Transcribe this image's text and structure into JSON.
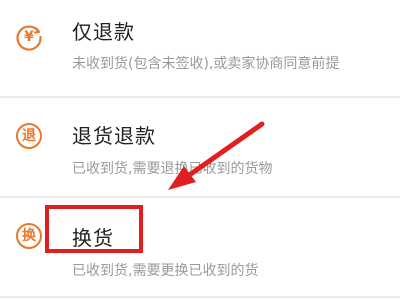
{
  "options": [
    {
      "icon": "yen-return-icon",
      "icon_char": "¥",
      "title": "仅退款",
      "desc": "未收到货(包含未签收),或卖家协商同意前提"
    },
    {
      "icon": "return-goods-icon",
      "icon_char": "退",
      "title": "退货退款",
      "desc": "已收到货,需要退换已收到的货物"
    },
    {
      "icon": "exchange-icon",
      "icon_char": "换",
      "title": "换货",
      "desc": "已收到货,需要更换已收到的货"
    }
  ],
  "colors": {
    "accent": "#e8782d",
    "highlight": "#e02020",
    "title": "#222222",
    "desc": "#9a9a9a"
  }
}
